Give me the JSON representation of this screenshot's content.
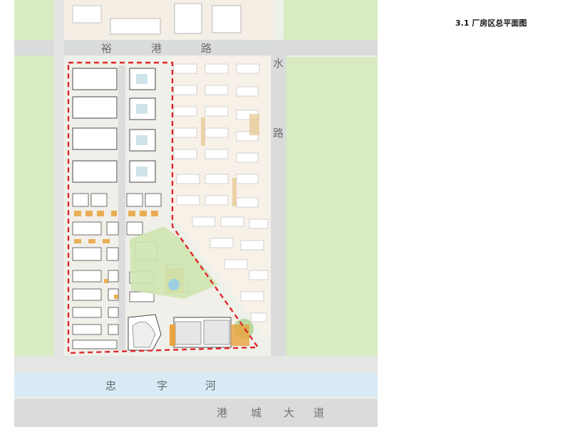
{
  "page": {
    "title": "3.1 厂房区总平面图"
  },
  "labels": {
    "road_top_1": "裕",
    "road_top_2": "港",
    "road_top_3": "路",
    "road_right_1": "水",
    "road_right_2": "路",
    "river_1": "忠",
    "river_2": "字",
    "river_3": "河",
    "avenue_1": "港",
    "avenue_2": "城",
    "avenue_3": "大",
    "avenue_4": "道"
  },
  "colors": {
    "boundary": "#e0262b",
    "road": "#dadcdc",
    "river": "#d9ecf4",
    "greenery": "#dcecc4",
    "accent": "#e8a33c"
  }
}
